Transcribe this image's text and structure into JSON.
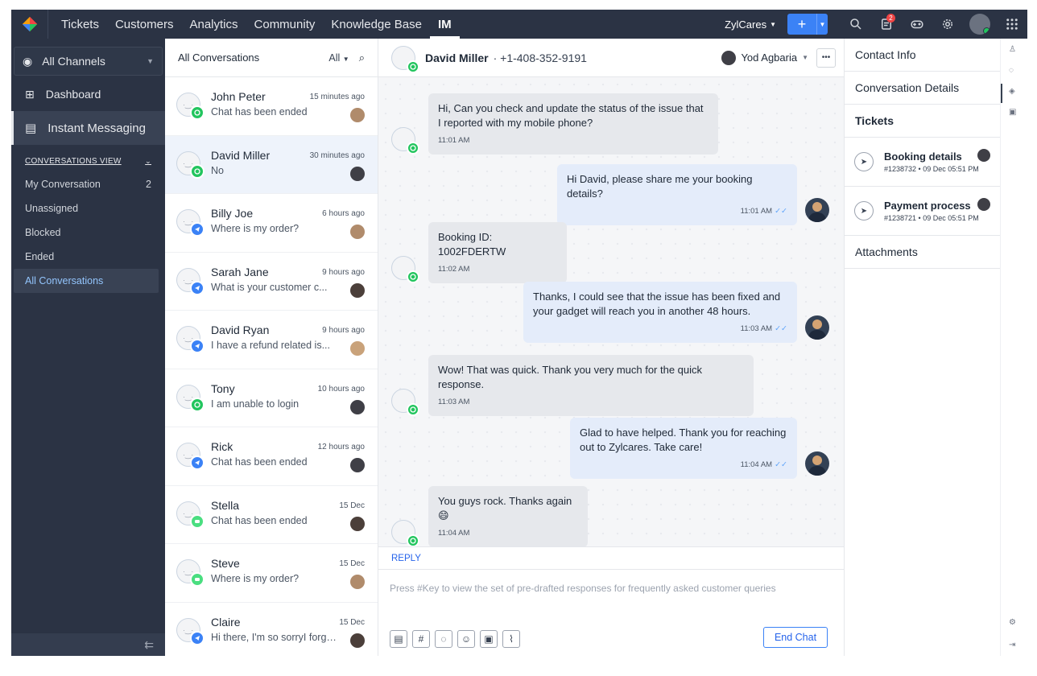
{
  "topnav": {
    "items": [
      "Tickets",
      "Customers",
      "Analytics",
      "Community",
      "Knowledge Base",
      "IM"
    ],
    "brand": "ZylCares",
    "plus": "+",
    "notif_count": "2"
  },
  "sidebar": {
    "channel": "All Channels",
    "items": [
      {
        "label": "Dashboard",
        "icon": "grid-icon"
      },
      {
        "label": "Instant Messaging",
        "icon": "chat-icon"
      }
    ],
    "section_title": "CONVERSATIONS VIEW",
    "views": [
      {
        "label": "My Conversation",
        "count": "2"
      },
      {
        "label": "Unassigned",
        "count": ""
      },
      {
        "label": "Blocked",
        "count": ""
      },
      {
        "label": "Ended",
        "count": ""
      },
      {
        "label": "All Conversations",
        "count": ""
      }
    ],
    "collapse": "⇇"
  },
  "convlist": {
    "title": "All Conversations",
    "filter": "All",
    "items": [
      {
        "name": "John Peter",
        "msg": "Chat has been ended",
        "time": "15 minutes ago",
        "channel": "wa",
        "agent_color": "#b08b6b"
      },
      {
        "name": "David Miller",
        "msg": "No",
        "time": "30 minutes ago",
        "channel": "wa",
        "agent_color": "#3f3f46"
      },
      {
        "name": "Billy Joe",
        "msg": "Where is my order?",
        "time": "6 hours ago",
        "channel": "tg",
        "agent_color": "#b08b6b"
      },
      {
        "name": "Sarah Jane",
        "msg": "What is your customer c...",
        "time": "9 hours ago",
        "channel": "tg",
        "agent_color": "#4b3f3a"
      },
      {
        "name": "David Ryan",
        "msg": "I have a refund related is...",
        "time": "9 hours ago",
        "channel": "tg",
        "agent_color": "#c9a27a"
      },
      {
        "name": "Tony",
        "msg": "I am unable to login",
        "time": "10 hours ago",
        "channel": "wa",
        "agent_color": "#3f3f46"
      },
      {
        "name": "Rick",
        "msg": "Chat has been ended",
        "time": "12 hours ago",
        "channel": "tg",
        "agent_color": "#3f3f46"
      },
      {
        "name": "Stella",
        "msg": "Chat has been ended",
        "time": "15 Dec",
        "channel": "lc",
        "agent_color": "#4b3f3a"
      },
      {
        "name": "Steve",
        "msg": "Where is my order?",
        "time": "15 Dec",
        "channel": "lc",
        "agent_color": "#b08b6b"
      },
      {
        "name": "Claire",
        "msg": "Hi there, I'm so sorryI forgot ...",
        "time": "15 Dec",
        "channel": "tg",
        "agent_color": "#4b3f3a"
      }
    ]
  },
  "chat": {
    "name": "David Miller",
    "phone": "· +1-408-352-9191",
    "assignee": "Yod Agbaria",
    "more": "•••",
    "messages": [
      {
        "dir": "in",
        "text": "Hi, Can you check and update the status of the issue that I reported with my mobile phone?",
        "time": "11:01 AM"
      },
      {
        "dir": "out",
        "text": "Hi David, please share me your booking details?",
        "time": "11:01 AM"
      },
      {
        "dir": "in",
        "text": "Booking ID: 1002FDERTW",
        "time": "11:02 AM"
      },
      {
        "dir": "out",
        "text": "Thanks, I could see that the issue has been fixed and your gadget will reach you in another 48 hours.",
        "time": "11:03 AM"
      },
      {
        "dir": "in",
        "text": "Wow! That was quick. Thank you very much for the quick response.",
        "time": "11:03 AM"
      },
      {
        "dir": "out",
        "text": "Glad to have helped. Thank you for reaching out to Zylcares. Take care!",
        "time": "11:04 AM"
      },
      {
        "dir": "in",
        "text": "You guys rock. Thanks again 😄",
        "time": "11:04 AM"
      }
    ],
    "reply_tab": "REPLY",
    "reply_placeholder": "Press #Key to view the set of pre-drafted responses for frequently asked customer queries",
    "end_chat": "End Chat"
  },
  "rpanel": {
    "contact_info": "Contact Info",
    "conversation_details": "Conversation Details",
    "tickets_title": "Tickets",
    "tickets": [
      {
        "name": "Booking details",
        "meta": "#1238732 • 09 Dec 05:51 PM"
      },
      {
        "name": "Payment process",
        "meta": "#1238721 • 09 Dec 05:51 PM"
      }
    ],
    "attachments": "Attachments"
  }
}
